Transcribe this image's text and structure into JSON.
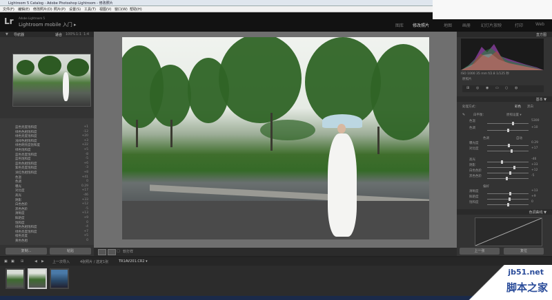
{
  "window": {
    "title": "Lightroom 5 Catalog - Adobe Photoshop Lightroom - 修改照片"
  },
  "menu": [
    "文件(F)",
    "编辑(E)",
    "修改照片(D)",
    "照片(P)",
    "设置(S)",
    "工具(T)",
    "视图(V)",
    "窗口(W)",
    "帮助(H)"
  ],
  "identity": {
    "logo": "Lr",
    "sub": "Adobe Lightroom 5",
    "mobile": "Lightroom mobile 入门 ▸"
  },
  "modules": [
    "图库",
    "修改照片",
    "地图",
    "画册",
    "幻灯片放映",
    "打印",
    "Web"
  ],
  "active_module": "修改照片",
  "navigator": {
    "title": "导航器",
    "zoom": [
      "适合",
      "100%",
      "1:1",
      "1:4"
    ]
  },
  "preset_rows": [
    {
      "label": "蓝色亮度饱和度",
      "value": "+1"
    },
    {
      "label": "绿色色相饱和度",
      "value": "-12"
    },
    {
      "label": "绿色亮度饱和度",
      "value": "+20"
    },
    {
      "label": "浅绿色相饱和度",
      "value": "+3"
    },
    {
      "label": "绿色明亮度饱和度",
      "value": "+22"
    },
    {
      "label": "绿色饱和度",
      "value": "+5"
    },
    {
      "label": "蓝色亮度饱和度",
      "value": "-8"
    },
    {
      "label": "蓝色饱和度",
      "value": "-5"
    },
    {
      "label": "蓝色色相饱和度",
      "value": "+6"
    },
    {
      "label": "紫色亮度饱和度",
      "value": "-3"
    },
    {
      "label": "洋红色相饱和度",
      "value": "+8"
    },
    {
      "label": "色温",
      "value": "+41"
    },
    {
      "label": "色调",
      "value": "0"
    },
    {
      "label": "曝光",
      "value": "0.29"
    },
    {
      "label": "对比度",
      "value": "+17"
    },
    {
      "label": "高光",
      "value": "-46"
    },
    {
      "label": "阴影",
      "value": "+33"
    },
    {
      "label": "白色色阶",
      "value": "+12"
    },
    {
      "label": "黑色色阶",
      "value": "-5"
    },
    {
      "label": "清晰度",
      "value": "+13"
    },
    {
      "label": "鲜艳度",
      "value": "+9"
    },
    {
      "label": "饱和度",
      "value": "0"
    },
    {
      "label": "绿色色相饱和度",
      "value": "-4"
    },
    {
      "label": "绿色亮度饱和度",
      "value": "+7"
    },
    {
      "label": "橙色亮度",
      "value": "+5"
    },
    {
      "label": "黄色色相",
      "value": "0"
    }
  ],
  "left_buttons": {
    "copy": "复制...",
    "paste": "粘贴"
  },
  "toolbar": {
    "softproof": "软打样"
  },
  "histogram": {
    "title": "直方图",
    "readout": "ISO 1000  35 mm  f/2.8  1/125 秒",
    "original": "原照片"
  },
  "basic": {
    "title": "基本 ▼",
    "process": "处理方式：",
    "color": "彩色",
    "bw": "黑白",
    "wb_label": "白平衡：",
    "wb_value": "原照设置 ▾",
    "tone": "色调",
    "auto": "自动",
    "presence": "偏好",
    "rows": [
      {
        "label": "色温",
        "value": "5300"
      },
      {
        "label": "色调",
        "value": "+10"
      },
      {
        "label": "曝光度",
        "value": "0.29"
      },
      {
        "label": "对比度",
        "value": "+17"
      },
      {
        "label": "高光",
        "value": "-46"
      },
      {
        "label": "阴影",
        "value": "+33"
      },
      {
        "label": "白色色阶",
        "value": "+12"
      },
      {
        "label": "黑色色阶",
        "value": "-5"
      },
      {
        "label": "清晰度",
        "value": "+13"
      },
      {
        "label": "鲜艳度",
        "value": "+9"
      },
      {
        "label": "饱和度",
        "value": "0"
      }
    ],
    "knobs": [
      0.62,
      0.5,
      0.52,
      0.58,
      0.35,
      0.66,
      0.56,
      0.46,
      0.56,
      0.54,
      0.5
    ]
  },
  "tonecurve": {
    "title": "色调曲线 ▼"
  },
  "right_buttons": {
    "prev": "上一张",
    "reset": "复位"
  },
  "filmstrip": {
    "nav": "上一次导入",
    "count": "4张照片 / 选定1张",
    "file": "TR1AV201.CR2 ▾"
  },
  "watermark": {
    "line1": "jb51.net",
    "line2": "脚本之家"
  }
}
